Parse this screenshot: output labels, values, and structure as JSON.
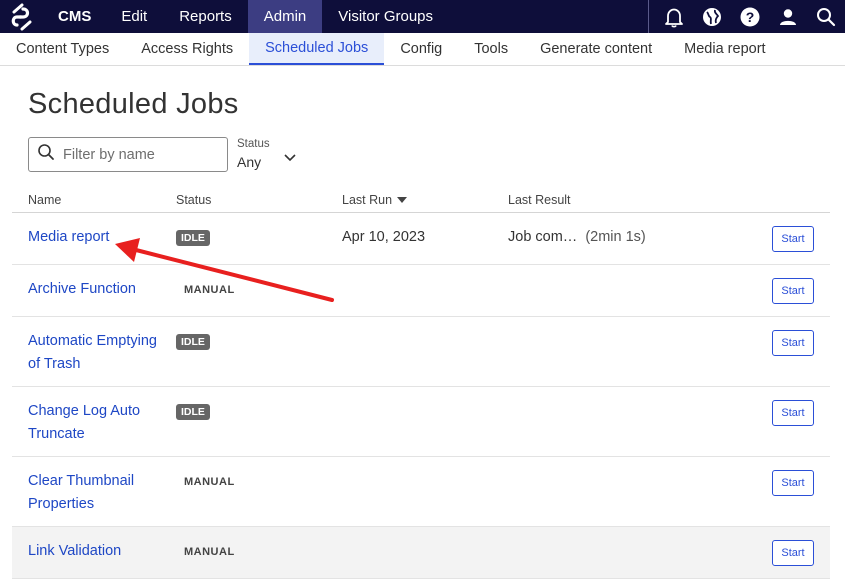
{
  "topbar": {
    "items": [
      {
        "label": "CMS"
      },
      {
        "label": "Edit"
      },
      {
        "label": "Reports"
      },
      {
        "label": "Admin"
      },
      {
        "label": "Visitor Groups"
      }
    ],
    "active": "Admin",
    "icons": [
      "bell-icon",
      "globe-icon",
      "help-icon",
      "user-icon",
      "search-icon"
    ]
  },
  "subnav": {
    "tabs": [
      {
        "label": "Content Types"
      },
      {
        "label": "Access Rights"
      },
      {
        "label": "Scheduled Jobs"
      },
      {
        "label": "Config"
      },
      {
        "label": "Tools"
      },
      {
        "label": "Generate content"
      },
      {
        "label": "Media report"
      }
    ],
    "active": "Scheduled Jobs"
  },
  "page": {
    "title": "Scheduled Jobs",
    "filter_placeholder": "Filter by name",
    "status_label": "Status",
    "status_value": "Any"
  },
  "table": {
    "headers": {
      "name": "Name",
      "status": "Status",
      "last_run": "Last Run",
      "last_result": "Last Result"
    },
    "sort_column": "Last Run",
    "sort_direction": "descending",
    "rows": [
      {
        "name": "Media report",
        "status": "IDLE",
        "last_run": "Apr 10, 2023",
        "result": "Job com…",
        "duration": "(2min 1s)",
        "action": "Start"
      },
      {
        "name": "Archive Function",
        "status": "MANUAL",
        "last_run": "",
        "result": "",
        "duration": "",
        "action": "Start"
      },
      {
        "name": "Automatic Emptying of Trash",
        "status": "IDLE",
        "last_run": "",
        "result": "",
        "duration": "",
        "action": "Start"
      },
      {
        "name": "Change Log Auto Truncate",
        "status": "IDLE",
        "last_run": "",
        "result": "",
        "duration": "",
        "action": "Start"
      },
      {
        "name": "Clear Thumbnail Properties",
        "status": "MANUAL",
        "last_run": "",
        "result": "",
        "duration": "",
        "action": "Start"
      },
      {
        "name": "Link Validation",
        "status": "MANUAL",
        "last_run": "",
        "result": "",
        "duration": "",
        "action": "Start"
      }
    ]
  },
  "colors": {
    "topbar_bg": "#0e0e3a",
    "active_top": "#3c3d82",
    "link": "#1e47c5",
    "accent": "#2b4fd7",
    "annotation_arrow": "#e8201f"
  }
}
